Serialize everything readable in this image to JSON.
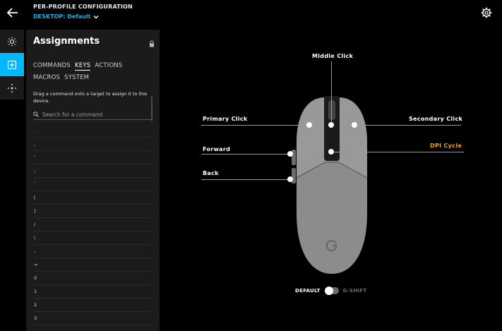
{
  "header": {
    "title": "PER-PROFILE CONFIGURATION",
    "profile_label": "DESKTOP: Default"
  },
  "panel": {
    "title": "Assignments",
    "tabs": [
      {
        "label": "COMMANDS",
        "active": false
      },
      {
        "label": "KEYS",
        "active": true
      },
      {
        "label": "ACTIONS",
        "active": false
      },
      {
        "label": "MACROS",
        "active": false
      },
      {
        "label": "SYSTEM",
        "active": false
      }
    ],
    "hint": "Drag a command onto a target to assign it to this device.",
    "search_placeholder": "Search for a command",
    "keys": [
      ".",
      ",",
      "'",
      ";",
      "`",
      "[",
      "]",
      "/",
      "\\",
      "-",
      "=",
      "0",
      "1",
      "2",
      "3"
    ]
  },
  "device": {
    "callouts": {
      "middle_click": "Middle Click",
      "primary_click": "Primary Click",
      "secondary_click": "Secondary Click",
      "forward": "Forward",
      "dpi_cycle": "DPI Cycle",
      "back": "Back"
    },
    "dpi_color": "#f0a30a"
  },
  "mode_toggle": {
    "on_label": "DEFAULT",
    "off_label": "G-SHIFT"
  },
  "colors": {
    "accent": "#00b8fc",
    "profile_link": "#1ab0e6"
  }
}
